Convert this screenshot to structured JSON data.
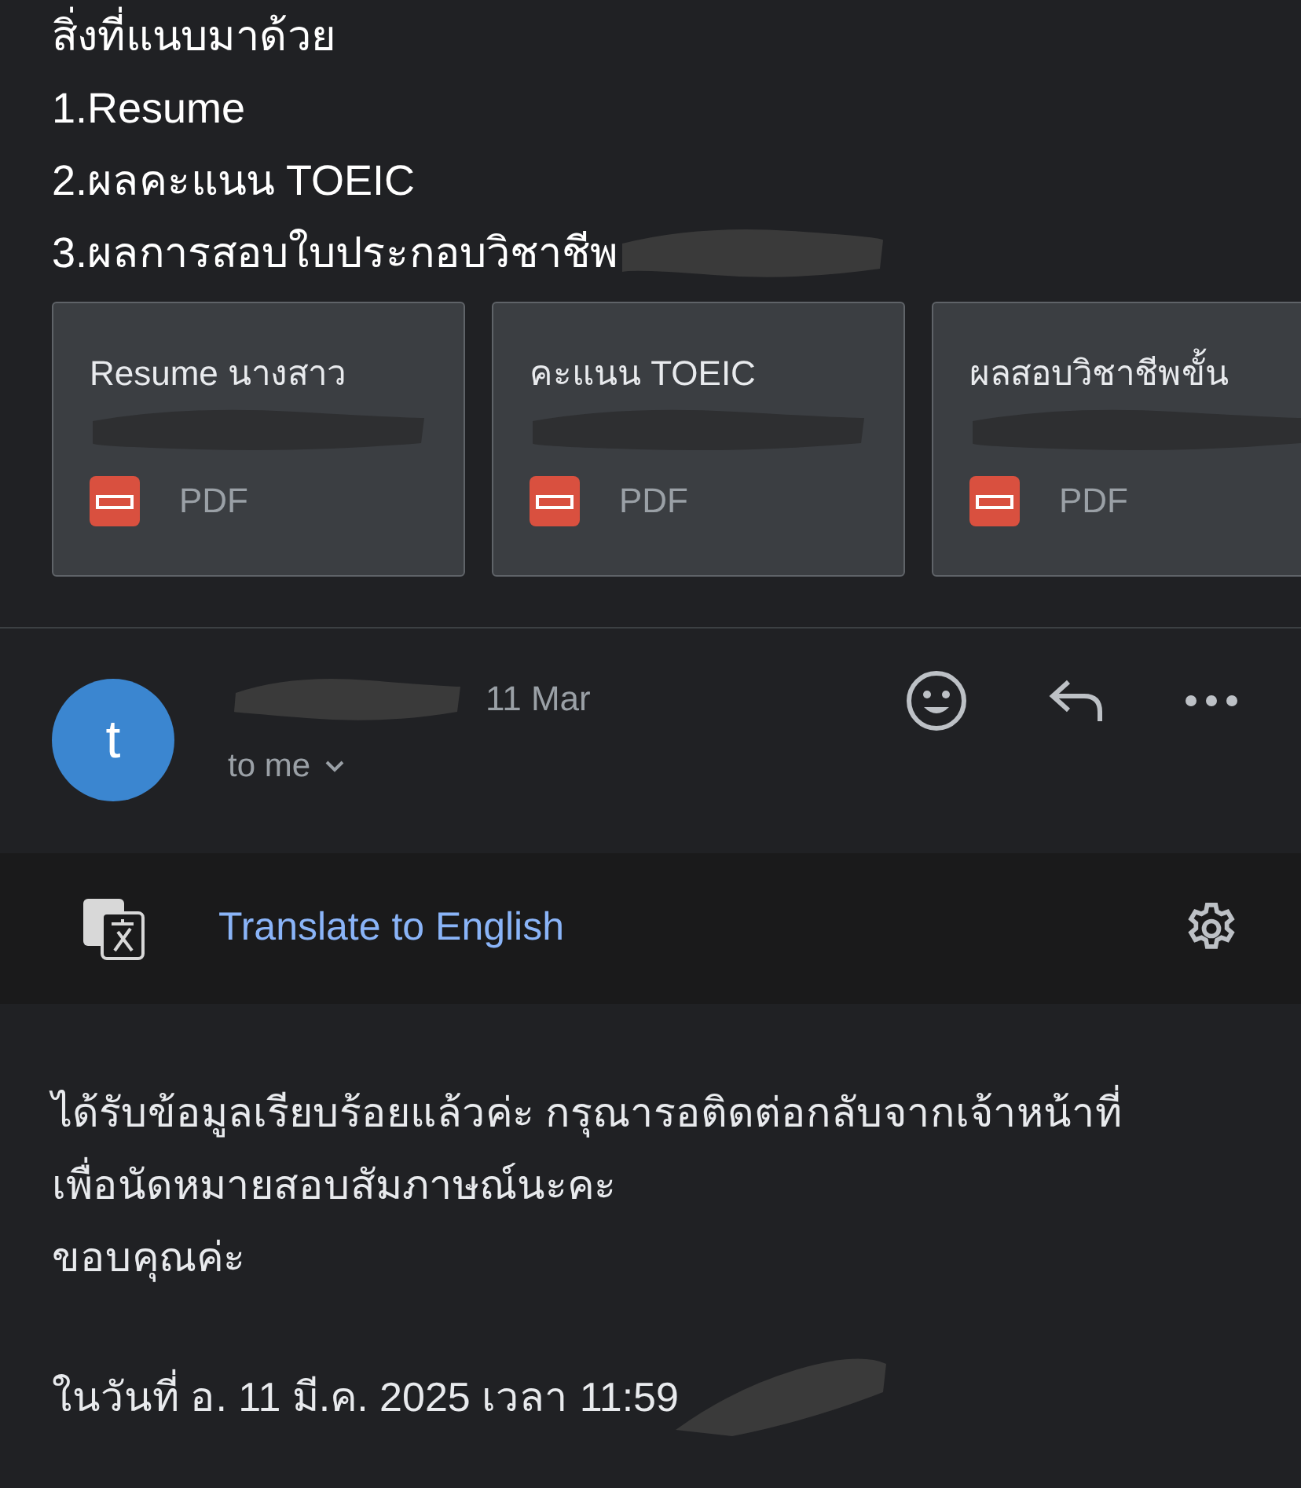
{
  "attachments_text": [
    "สิ่งที่แนบมาด้วย",
    "1.Resume",
    "2.ผลคะแนน TOEIC",
    "3.ผลการสอบใบประกอบวิชาชีพ"
  ],
  "attachments": [
    {
      "title": "Resume นางสาว",
      "type": "PDF"
    },
    {
      "title": "คะแนน TOEIC",
      "type": "PDF"
    },
    {
      "title": "ผลสอบวิชาชีพขั้น",
      "type": "PDF"
    }
  ],
  "message": {
    "avatar_letter": "t",
    "date": "11 Mar",
    "recipient": "to me"
  },
  "translate_bar": {
    "label": "Translate to English"
  },
  "reply_body": [
    "ได้รับข้อมูลเรียบร้อยแล้วค่ะ กรุณารอติดต่อกลับจากเจ้าหน้าที่ เพื่อนัดหมายสอบสัมภาษณ์นะคะ",
    "ขอบคุณค่ะ"
  ],
  "quote_line": "ในวันที่ อ. 11 มี.ค. 2025 เวลา 11:59"
}
